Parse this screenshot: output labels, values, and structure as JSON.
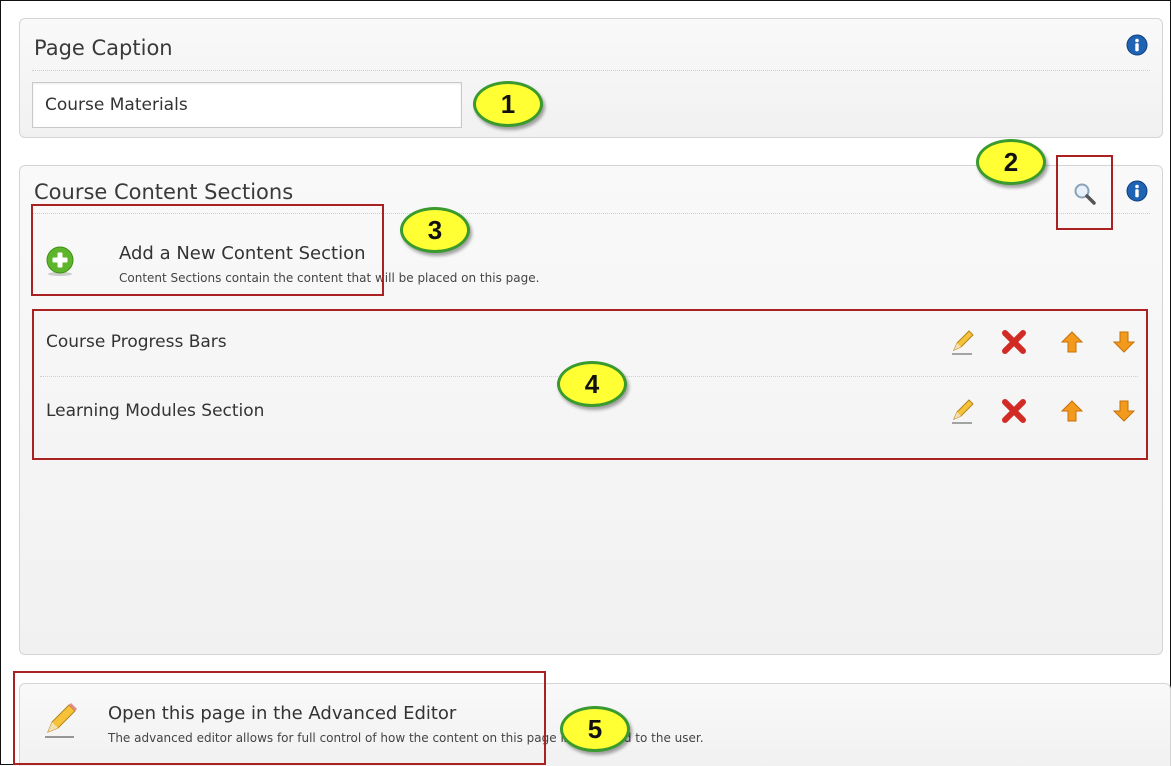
{
  "page_caption": {
    "title": "Page Caption",
    "value": "Course Materials"
  },
  "content_sections": {
    "title": "Course Content Sections",
    "add": {
      "label": "Add a New Content Section",
      "description": "Content Sections contain the content that will be placed on this page."
    },
    "rows": [
      {
        "label": "Course Progress Bars"
      },
      {
        "label": "Learning Modules Section"
      }
    ]
  },
  "advanced_editor": {
    "label": "Open this page in the Advanced Editor",
    "description": "The advanced editor allows for full control of how the content on this page is displayed to the user."
  },
  "callouts": [
    "1",
    "2",
    "3",
    "4",
    "5"
  ],
  "icons": {
    "info": "info-icon",
    "search": "magnifier-icon",
    "add": "plus-circle-icon",
    "edit": "pencil-icon",
    "delete": "red-x-icon",
    "move_up": "up-arrow-icon",
    "move_down": "down-arrow-icon"
  },
  "colors": {
    "info_blue": "#1f63b5",
    "add_green": "#5db52b",
    "delete_red": "#d22a25",
    "arrow_orange": "#f39a1c",
    "callout_yellow": "#ffff33",
    "callout_border": "#3a9a2e",
    "highlight_red": "#a92121"
  }
}
